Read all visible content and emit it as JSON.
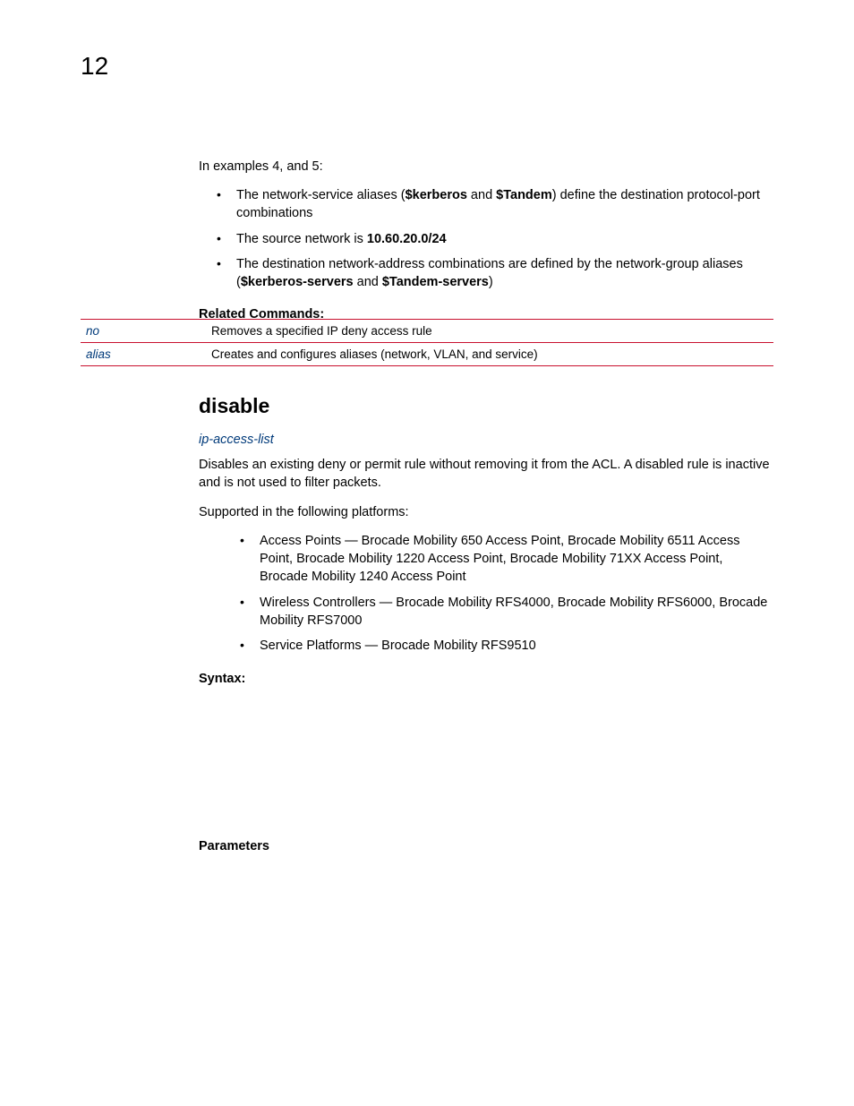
{
  "page_number": "12",
  "intro": "In examples 4, and 5:",
  "bullets": {
    "b1_prefix": "The network-service aliases (",
    "b1_bold1": "$kerberos",
    "b1_mid": " and ",
    "b1_bold2": "$Tandem",
    "b1_suffix": ") define the destination protocol-port combinations",
    "b2_prefix": "The source network is ",
    "b2_bold": "10.60.20.0/24",
    "b3_prefix": "The destination network-address combinations are defined by the network-group aliases (",
    "b3_bold1": "$kerberos-servers",
    "b3_mid": " and ",
    "b3_bold2": "$Tandem-servers",
    "b3_suffix": ")"
  },
  "related_label": "Related Commands:",
  "related_table": [
    {
      "cmd": "no",
      "desc": "Removes a specified IP deny access rule"
    },
    {
      "cmd": "alias",
      "desc": "Creates and configures aliases (network, VLAN, and service)"
    }
  ],
  "heading2": "disable",
  "subhead_link": "ip-access-list",
  "desc_para": "Disables an existing deny or permit rule without removing it from the ACL. A disabled rule is inactive and is not used to filter packets.",
  "supported_intro": "Supported in the following platforms:",
  "platforms": [
    "Access Points — Brocade Mobility 650 Access Point, Brocade Mobility 6511 Access Point, Brocade Mobility 1220 Access Point, Brocade Mobility 71XX Access Point, Brocade Mobility 1240 Access Point",
    "Wireless Controllers — Brocade Mobility RFS4000, Brocade Mobility RFS6000, Brocade Mobility RFS7000",
    "Service Platforms — Brocade Mobility RFS9510"
  ],
  "syntax_label": "Syntax:",
  "parameters_label": "Parameters"
}
